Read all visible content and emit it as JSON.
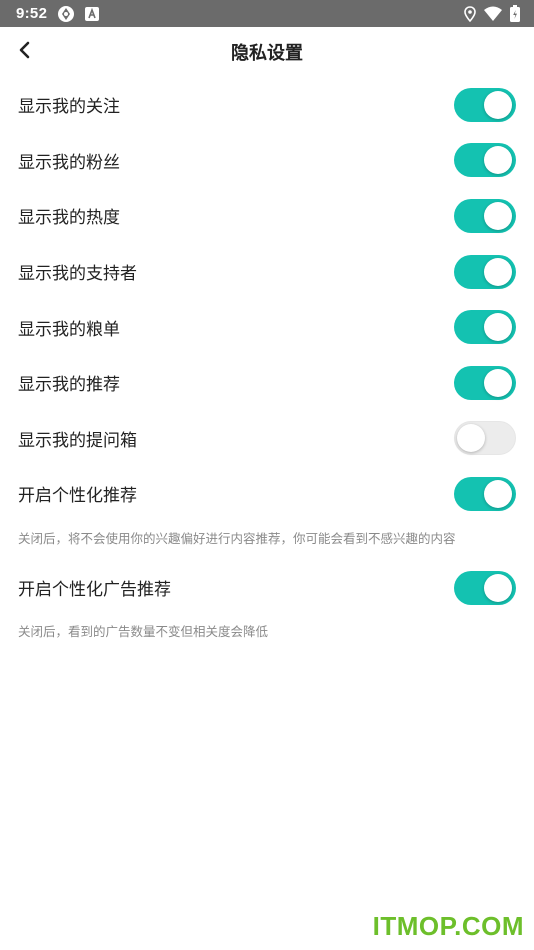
{
  "status_bar": {
    "time": "9:52",
    "icons_left": [
      "sync-icon",
      "app-a-icon"
    ],
    "icons_right": [
      "location-icon",
      "wifi-icon",
      "battery-icon"
    ]
  },
  "header": {
    "title": "隐私设置",
    "back_icon": "chevron-left-icon"
  },
  "settings": [
    {
      "label": "显示我的关注",
      "enabled": true
    },
    {
      "label": "显示我的粉丝",
      "enabled": true
    },
    {
      "label": "显示我的热度",
      "enabled": true
    },
    {
      "label": "显示我的支持者",
      "enabled": true
    },
    {
      "label": "显示我的粮单",
      "enabled": true
    },
    {
      "label": "显示我的推荐",
      "enabled": true
    },
    {
      "label": "显示我的提问箱",
      "enabled": false
    },
    {
      "label": "开启个性化推荐",
      "enabled": true,
      "note": "关闭后，将不会使用你的兴趣偏好进行内容推荐，你可能会看到不感兴趣的内容"
    },
    {
      "label": "开启个性化广告推荐",
      "enabled": true,
      "note": "关闭后，看到的广告数量不变但相关度会降低"
    }
  ],
  "colors": {
    "accent": "#14c2b1",
    "status_bar": "#6b6b6b",
    "note_text": "#8a8a8a"
  },
  "watermark": "ITMOP.COM"
}
